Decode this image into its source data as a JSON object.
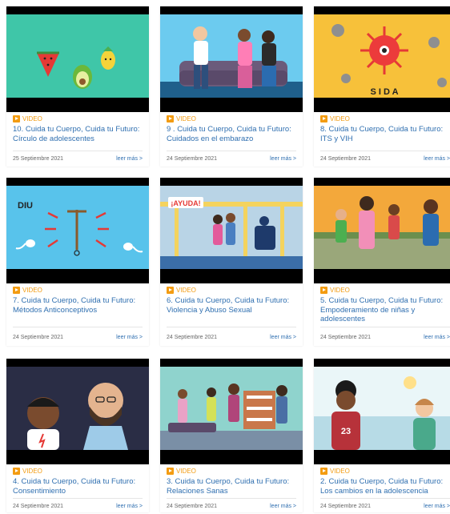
{
  "cards": [
    {
      "type_label": "VIDEO",
      "title": "10. Cuida tu Cuerpo, Cuida tu Futuro: Círculo de adolescentes",
      "date": "25 Septiembre 2021",
      "more": "leer más >"
    },
    {
      "type_label": "VIDEO",
      "title": "9 . Cuida tu Cuerpo, Cuida tu Futuro: Cuidados en el embarazo",
      "date": "24 Septiembre 2021",
      "more": "leer más >"
    },
    {
      "type_label": "VIDEO",
      "title": "8. Cuida tu Cuerpo, Cuida tu Futuro: ITS y VIH",
      "date": "24 Septiembre 2021",
      "more": "leer más >",
      "thumb_text": "S I D A"
    },
    {
      "type_label": "VIDEO",
      "title": "7. Cuida tu Cuerpo, Cuida tu Futuro: Métodos Anticonceptivos",
      "date": "24 Septiembre 2021",
      "more": "leer más >",
      "thumb_text": "DIU"
    },
    {
      "type_label": "VIDEO",
      "title": "6. Cuida tu Cuerpo, Cuida tu Futuro: Violencia y Abuso Sexual",
      "date": "24 Septiembre 2021",
      "more": "leer más >",
      "thumb_text": "¡AYUDA!"
    },
    {
      "type_label": "VIDEO",
      "title": "5. Cuida tu Cuerpo, Cuida tu Futuro: Empoderamiento de niñas y adolescentes",
      "date": "24 Septiembre 2021",
      "more": "leer más >"
    },
    {
      "type_label": "VIDEO",
      "title": "4. Cuida tu Cuerpo, Cuida tu Futuro: Consentimiento",
      "date": "24 Septiembre 2021",
      "more": "leer más >"
    },
    {
      "type_label": "VIDEO",
      "title": "3. Cuida tu Cuerpo, Cuida tu Futuro: Relaciones Sanas",
      "date": "24 Septiembre 2021",
      "more": "leer más >"
    },
    {
      "type_label": "VIDEO",
      "title": "2. Cuida tu Cuerpo, Cuida tu Futuro: Los cambios en la adolescencia",
      "date": "24 Septiembre 2021",
      "more": "leer más >",
      "thumb_text": "23"
    }
  ],
  "colors": {
    "accent": "#f39c12",
    "link": "#2f6fb0",
    "date": "#666666"
  }
}
